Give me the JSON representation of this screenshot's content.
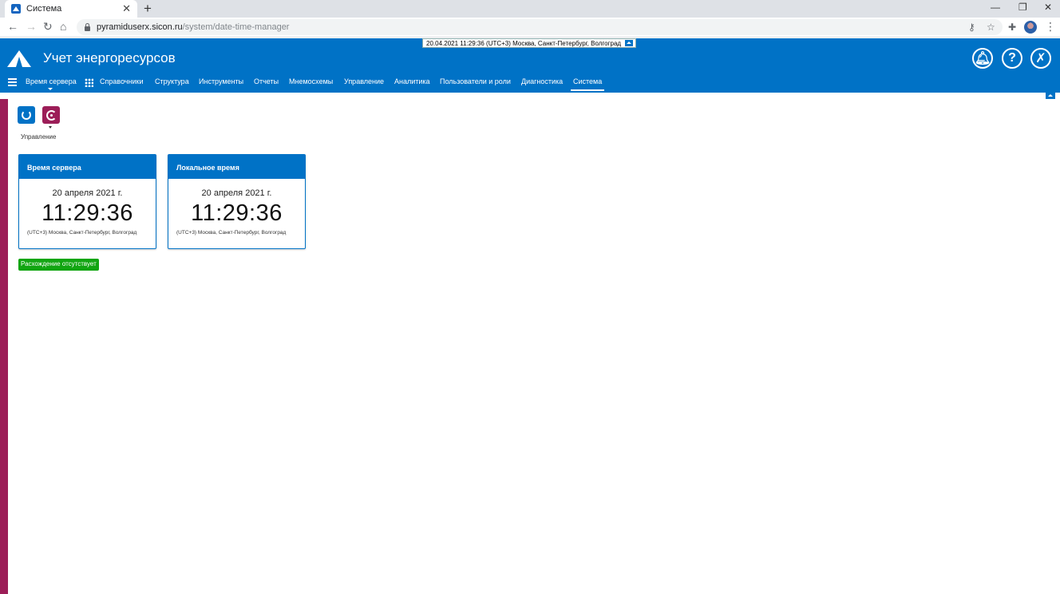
{
  "browser": {
    "tab_title": "Система",
    "url_host": "pyramiduserx.sicon.ru",
    "url_path": "/system/date-time-manager"
  },
  "header": {
    "app_title": "Учет энергоресурсов",
    "time_banner": "20.04.2021 11:29:36 (UTC+3) Москва, Санкт-Петербург, Волгоград",
    "icons": [
      "bell-icon",
      "help-icon",
      "logout-icon"
    ]
  },
  "menu": {
    "items": [
      {
        "label": "Время сервера"
      },
      {
        "label": "Справочники"
      },
      {
        "label": "Структура"
      },
      {
        "label": "Инструменты"
      },
      {
        "label": "Отчеты"
      },
      {
        "label": "Мнемосхемы"
      },
      {
        "label": "Управление"
      },
      {
        "label": "Аналитика"
      },
      {
        "label": "Пользователи и роли"
      },
      {
        "label": "Диагностика"
      },
      {
        "label": "Система"
      }
    ],
    "active": "Система"
  },
  "tools": {
    "label": "Управление",
    "icons": [
      "refresh-icon",
      "clock-settings-icon"
    ]
  },
  "cards": [
    {
      "title": "Время сервера",
      "date": "20 апреля 2021 г.",
      "time": "11:29:36",
      "timezone": "(UTC+3) Москва, Санкт-Петербург, Волгоград"
    },
    {
      "title": "Локальное время",
      "date": "20 апреля 2021 г.",
      "time": "11:29:36",
      "timezone": "(UTC+3) Москва, Санкт-Петербург, Волгоград"
    }
  ],
  "status": {
    "text": "Расхождение отсутствует",
    "color": "#11a511"
  },
  "colors": {
    "primary": "#0072c6",
    "accent": "#9c1e58"
  }
}
